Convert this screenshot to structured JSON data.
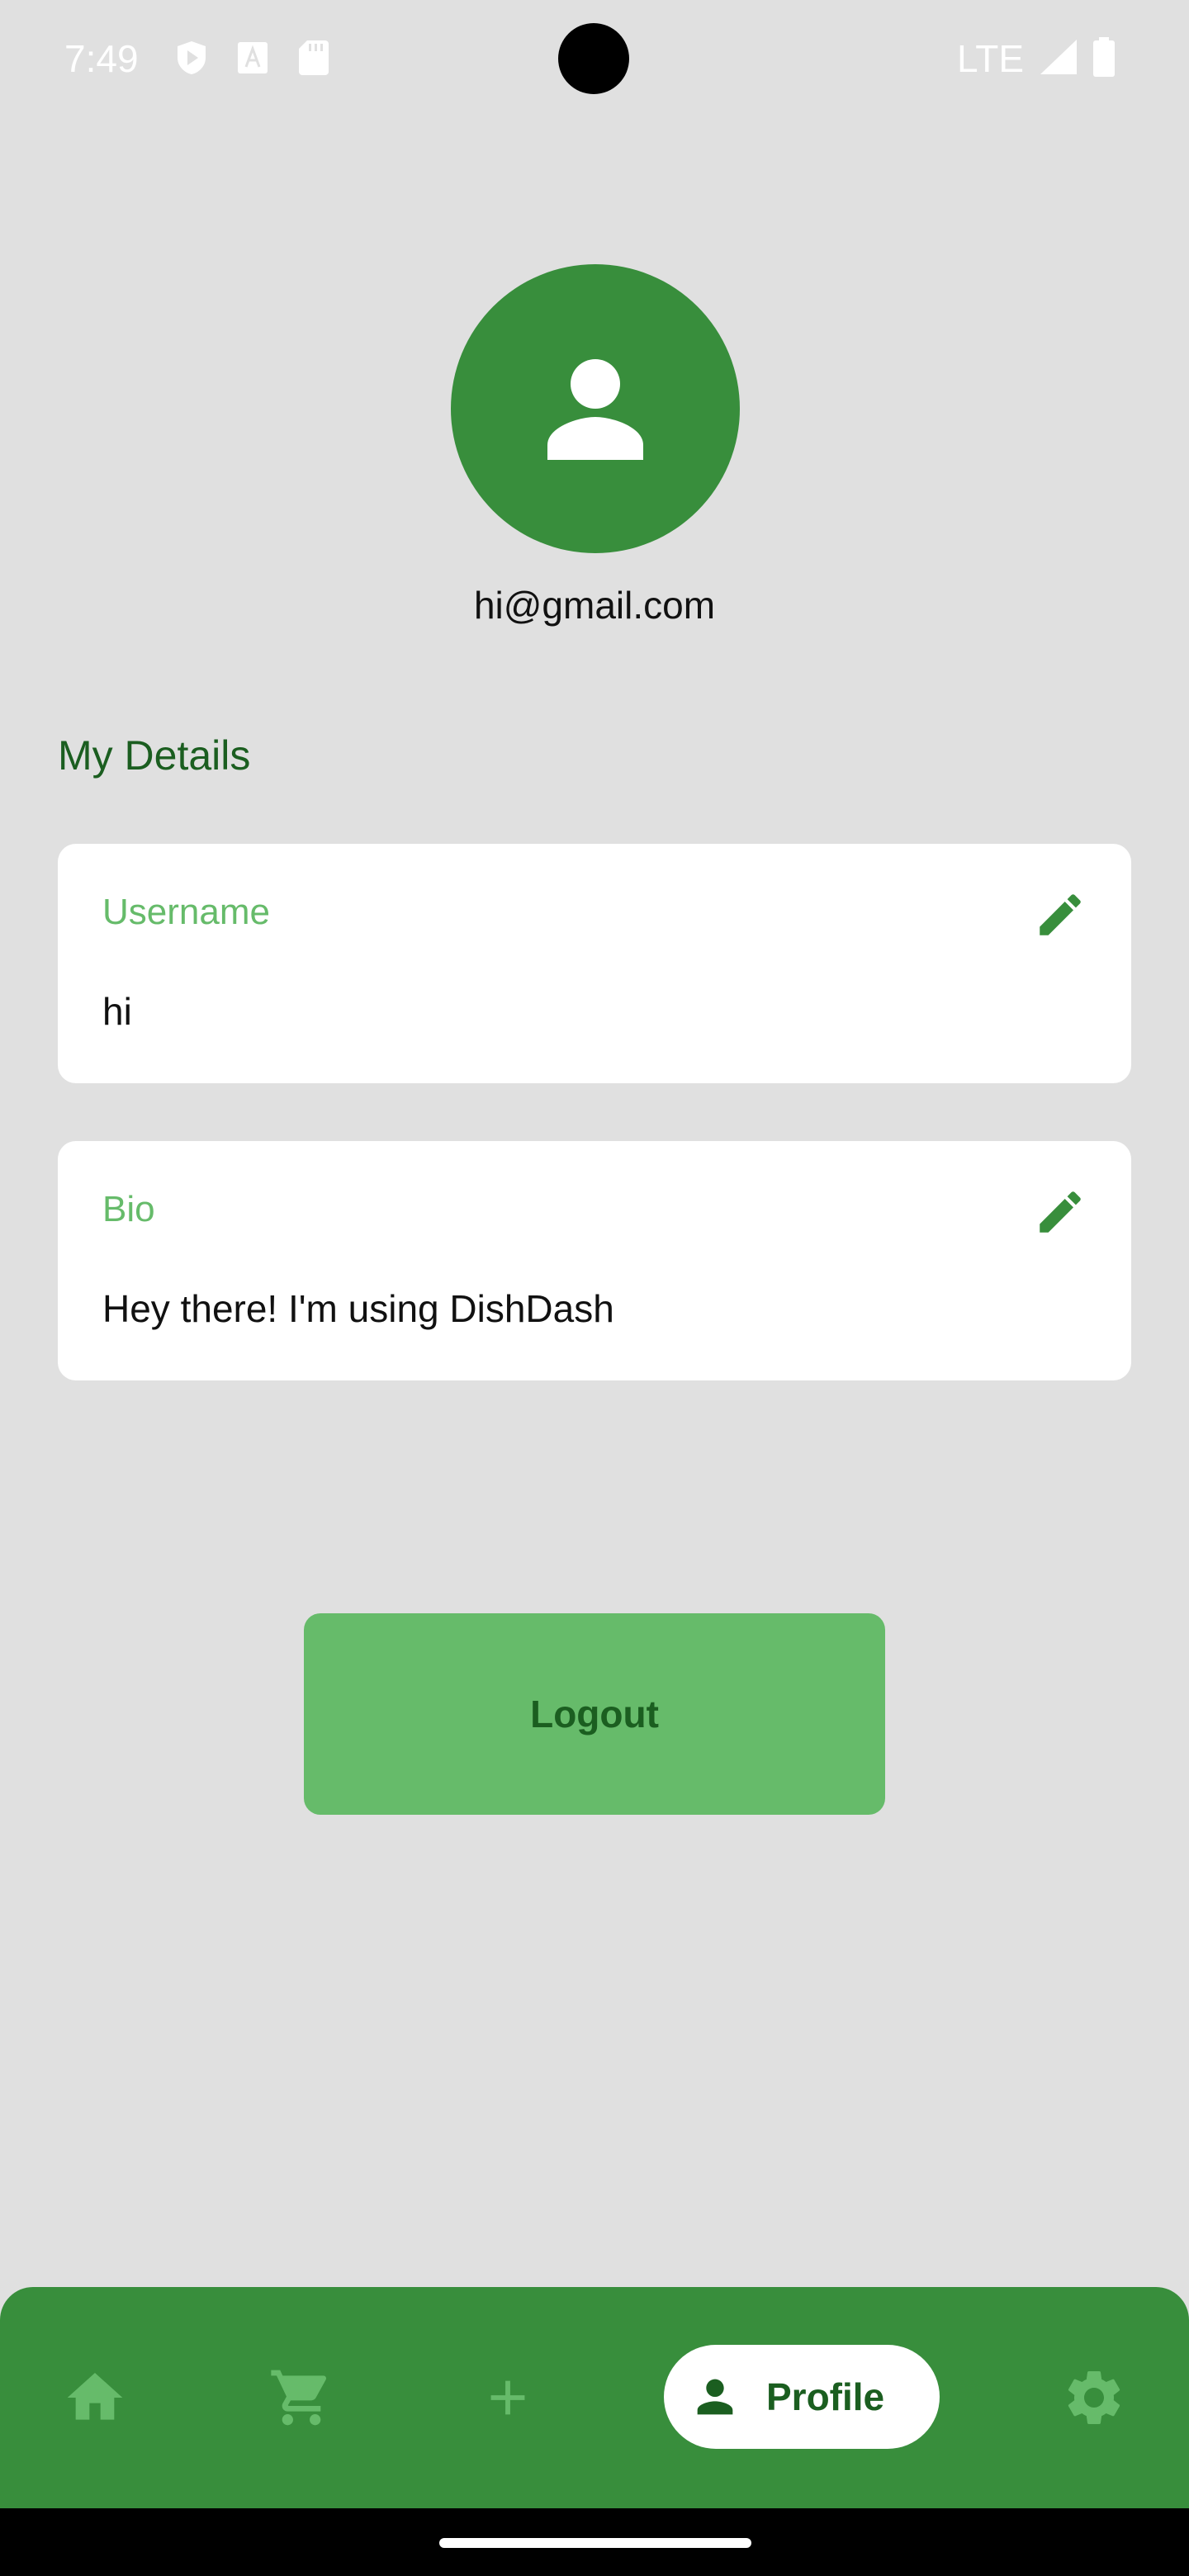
{
  "status_bar": {
    "time": "7:49",
    "network": "LTE",
    "icons": [
      "shield-play-icon",
      "font-a-icon",
      "sd-card-icon",
      "signal-icon",
      "battery-icon"
    ]
  },
  "profile": {
    "avatar_icon": "person-icon",
    "email": "hi@gmail.com"
  },
  "details": {
    "title": "My Details",
    "username_label": "Username",
    "username_value": "hi",
    "bio_label": "Bio",
    "bio_value": "Hey there! I'm using DishDash"
  },
  "actions": {
    "logout_label": "Logout"
  },
  "bottom_nav": {
    "items": [
      {
        "icon": "home-icon"
      },
      {
        "icon": "cart-icon"
      },
      {
        "icon": "add-icon"
      },
      {
        "icon": "person-icon",
        "label": "Profile",
        "active": true
      },
      {
        "icon": "gear-icon"
      }
    ]
  },
  "colors": {
    "primary": "#388e3c",
    "primary_light": "#66bb6a",
    "primary_dark": "#1b5e20",
    "background": "#e0e0e0",
    "card": "#ffffff"
  }
}
